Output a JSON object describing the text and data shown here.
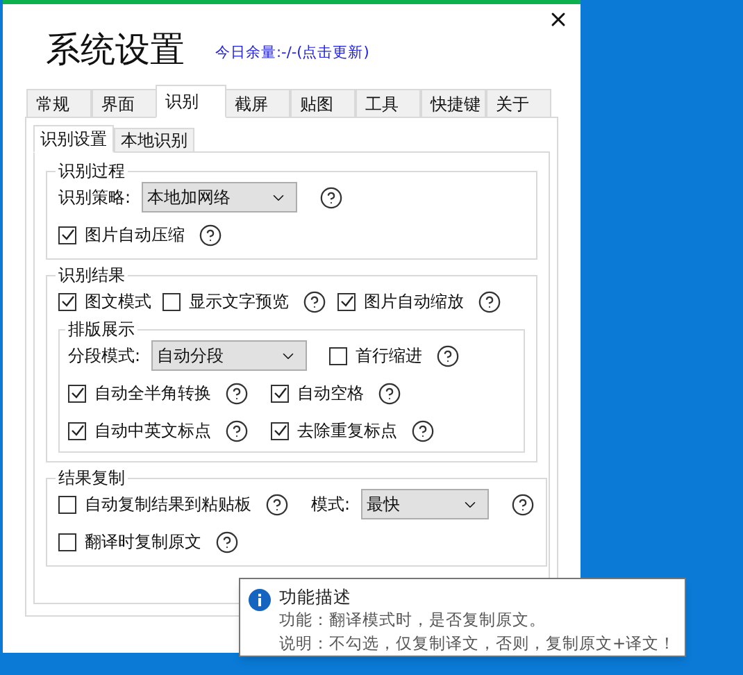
{
  "window": {
    "title": "系统设置",
    "quota_link": "今日余量:-/-(点击更新)"
  },
  "tabs": [
    {
      "label": "常规",
      "selected": false
    },
    {
      "label": "界面",
      "selected": false
    },
    {
      "label": "识别",
      "selected": true
    },
    {
      "label": "截屏",
      "selected": false
    },
    {
      "label": "贴图",
      "selected": false
    },
    {
      "label": "工具",
      "selected": false
    },
    {
      "label": "快捷键",
      "selected": false
    },
    {
      "label": "关于",
      "selected": false
    }
  ],
  "subtabs": [
    {
      "label": "识别设置",
      "selected": true
    },
    {
      "label": "本地识别",
      "selected": false
    }
  ],
  "groups": [
    {
      "title": "识别过程",
      "rows": [
        [
          {
            "kind": "select",
            "label": "识别策略:",
            "value": "本地加网络",
            "help": true
          }
        ],
        [
          {
            "kind": "checkbox",
            "label": "图片自动压缩",
            "checked": true,
            "help": true
          }
        ]
      ]
    },
    {
      "title": "识别结果",
      "rows": [
        [
          {
            "kind": "checkbox",
            "label": "图文模式",
            "checked": true,
            "help": false
          },
          {
            "kind": "checkbox",
            "label": "显示文字预览",
            "checked": false,
            "help": true
          },
          {
            "kind": "checkbox",
            "label": "图片自动缩放",
            "checked": true,
            "help": true
          }
        ]
      ],
      "subgroup": {
        "title": "排版展示",
        "rows": [
          [
            {
              "kind": "select",
              "label": "分段模式:",
              "value": "自动分段",
              "help": false
            },
            {
              "kind": "checkbox",
              "label": "首行缩进",
              "checked": false,
              "help": true
            }
          ],
          [
            {
              "kind": "checkbox",
              "label": "自动全半角转换",
              "checked": true,
              "help": true
            },
            {
              "kind": "checkbox",
              "label": "自动空格",
              "checked": true,
              "help": true
            }
          ],
          [
            {
              "kind": "checkbox",
              "label": "自动中英文标点",
              "checked": true,
              "help": true
            },
            {
              "kind": "checkbox",
              "label": "去除重复标点",
              "checked": true,
              "help": true
            }
          ]
        ]
      }
    },
    {
      "title": "结果复制",
      "rows": [
        [
          {
            "kind": "checkbox",
            "label": "自动复制结果到粘贴板",
            "checked": false,
            "help": true
          },
          {
            "kind": "select",
            "label": "模式:",
            "value": "最快",
            "help": true
          }
        ],
        [
          {
            "kind": "checkbox",
            "label": "翻译时复制原文",
            "checked": false,
            "help": true
          }
        ]
      ]
    }
  ],
  "tooltip": {
    "title": "功能描述",
    "lines": [
      "功能：翻译模式时，是否复制原文。",
      "说明：不勾选，仅复制译文，否则，复制原文+译文！"
    ]
  }
}
